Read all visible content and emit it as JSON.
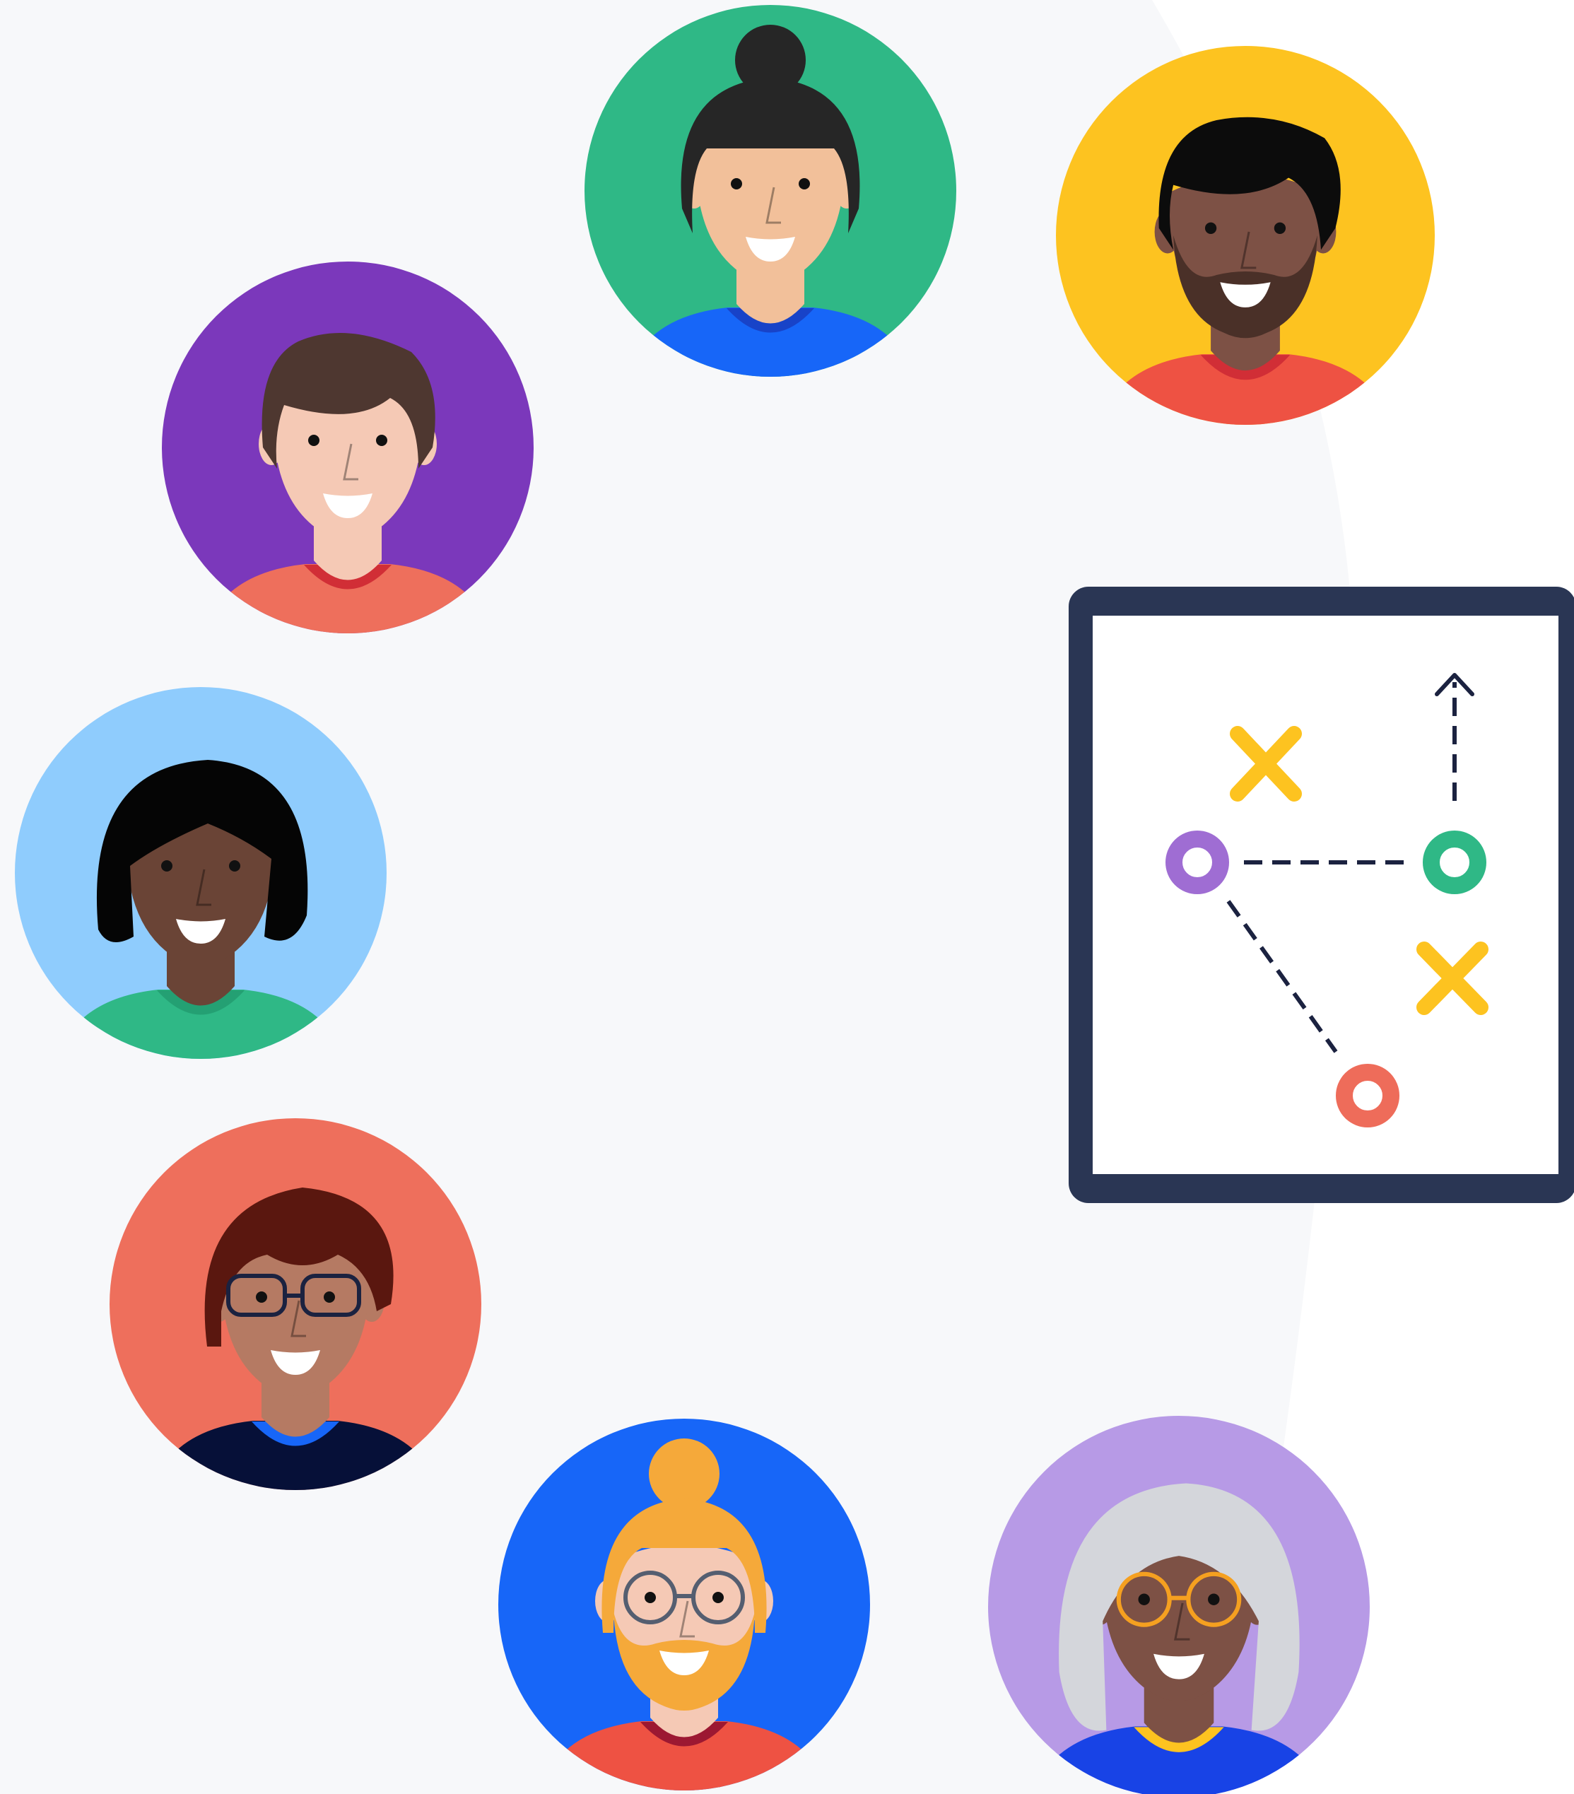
{
  "colors": {
    "page_background": "#ffffff",
    "arc_background": "#f7f8fa",
    "board_frame": "#2a3654",
    "board_surface": "#ffffff",
    "marker_x": "#fdc320",
    "marker_purple": "#9f6dd3",
    "marker_green": "#2fb886",
    "marker_red": "#ee6c5a",
    "dash_line": "#1b2240"
  },
  "avatars": [
    {
      "name": "woman-bun-green",
      "background": "#2fb886",
      "skin": "#f2c09a",
      "hair": "#262626",
      "shirt": "#1766f8",
      "collar": "#1843c8",
      "accessory": "none"
    },
    {
      "name": "man-beard-yellow",
      "background": "#fdc320",
      "skin": "#7d5145",
      "hair": "#0c0c0c",
      "shirt": "#ee5243",
      "collar": "#d12e36",
      "accessory": "beard"
    },
    {
      "name": "man-brown-hair-purple",
      "background": "#7b38bb",
      "skin": "#f5c9b5",
      "hair": "#4e3730",
      "shirt": "#ee6f5c",
      "collar": "#d12e36",
      "accessory": "none"
    },
    {
      "name": "woman-bob-lightblue",
      "background": "#8fccfd",
      "skin": "#6a4436",
      "hair": "#050505",
      "shirt": "#2fb886",
      "collar": "#24a073",
      "accessory": "none"
    },
    {
      "name": "woman-glasses-red",
      "background": "#ee6f5c",
      "skin": "#b57a63",
      "hair": "#5a170f",
      "shirt": "#061038",
      "collar": "#1766f8",
      "accessory": "glasses"
    },
    {
      "name": "man-ginger-bun-blue",
      "background": "#1766f8",
      "skin": "#f5c9b5",
      "hair": "#f5a93a",
      "shirt": "#ee5243",
      "collar": "#9c1832",
      "accessory": "round-glasses"
    },
    {
      "name": "woman-gray-hair-lavender",
      "background": "#b79ae6",
      "skin": "#7d5145",
      "hair": "#d4d6db",
      "shirt": "#1843e6",
      "collar": "#fdc320",
      "accessory": "gold-glasses"
    }
  ],
  "board": {
    "icon": "strategy-play-board",
    "markers": [
      "x-marker",
      "x-marker",
      "purple-circle",
      "green-circle",
      "red-circle"
    ],
    "arrow": "up-arrow"
  }
}
